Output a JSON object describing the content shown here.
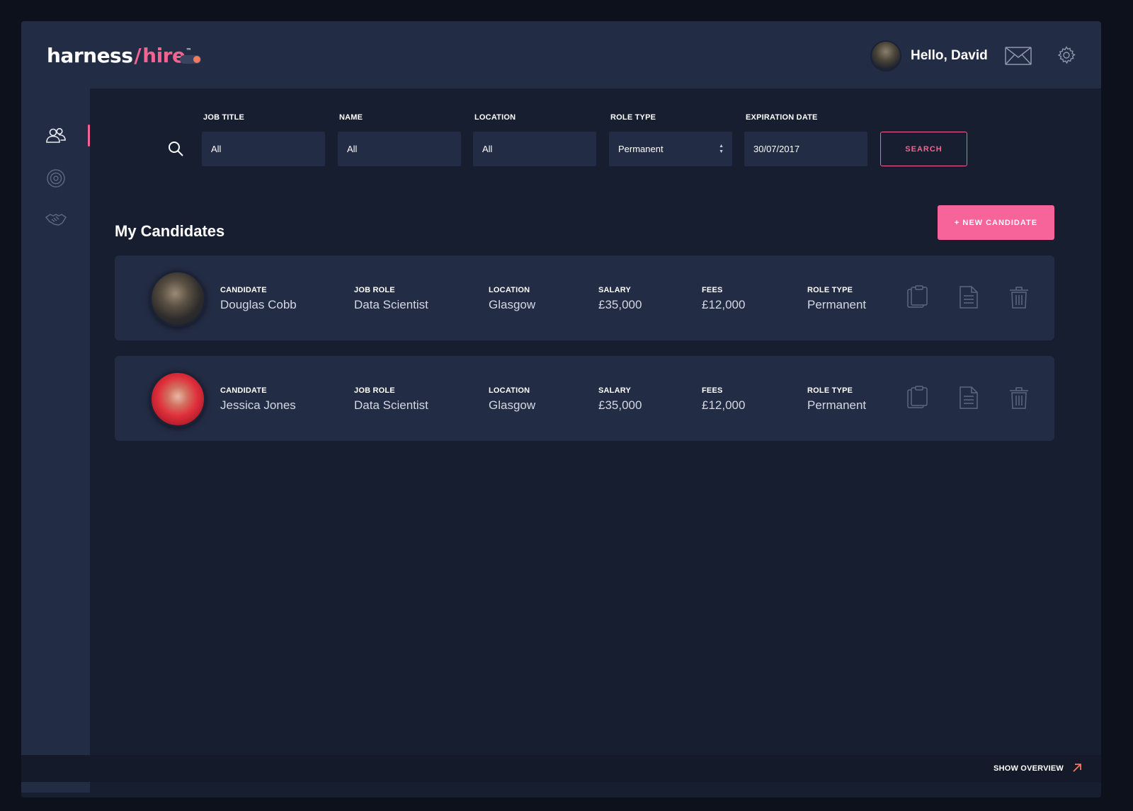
{
  "header": {
    "logo": {
      "part1": "harness",
      "slash": "/",
      "part2": "hire",
      "tm": "™"
    },
    "greeting": "Hello, David",
    "icons": [
      "user-avatar",
      "mail-icon",
      "gear-icon"
    ],
    "accent_color": "#f3638f"
  },
  "sidebar": {
    "items": [
      {
        "icon": "candidates-icon",
        "active": true
      },
      {
        "icon": "target-icon",
        "active": false
      },
      {
        "icon": "handshake-icon",
        "active": false
      }
    ]
  },
  "filters": {
    "job_title": {
      "label": "JOB TITLE",
      "value": "All"
    },
    "name": {
      "label": "NAME",
      "value": "All"
    },
    "location": {
      "label": "LOCATION",
      "value": "All"
    },
    "role_type": {
      "label": "ROLE TYPE",
      "value": "Permanent"
    },
    "expiration_date": {
      "label": "EXPIRATION DATE",
      "value": "30/07/2017"
    },
    "search_label": "SEARCH"
  },
  "main": {
    "title": "My Candidates",
    "new_candidate_label": "+ NEW CANDIDATE",
    "field_labels": {
      "candidate": "CANDIDATE",
      "job_role": "JOB ROLE",
      "location": "LOCATION",
      "salary": "SALARY",
      "fees": "FEES",
      "role_type": "ROLE TYPE"
    },
    "candidates": [
      {
        "name": "Douglas Cobb",
        "job_role": "Data Scientist",
        "location": "Glasgow",
        "salary": "£35,000",
        "fees": "£12,000",
        "role_type": "Permanent"
      },
      {
        "name": "Jessica Jones",
        "job_role": "Data Scientist",
        "location": "Glasgow",
        "salary": "£35,000",
        "fees": "£12,000",
        "role_type": "Permanent"
      }
    ]
  },
  "footer": {
    "show_overview_label": "SHOW OVERVIEW"
  }
}
